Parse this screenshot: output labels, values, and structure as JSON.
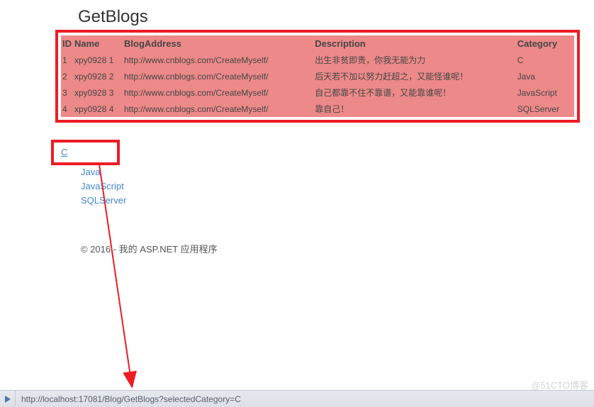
{
  "page_title": "GetBlogs",
  "table": {
    "headers": {
      "id": "ID",
      "name": "Name",
      "address": "BlogAddress",
      "description": "Description",
      "category": "Category"
    },
    "rows": [
      {
        "id": "1",
        "name": "xpy0928 1",
        "address": "http://www.cnblogs.com/CreateMyself/",
        "description": "出生非贫即贵，你我无能为力",
        "category": "C"
      },
      {
        "id": "2",
        "name": "xpy0928 2",
        "address": "http://www.cnblogs.com/CreateMyself/",
        "description": "后天若不加以努力赶超之，又能怪谁呢！",
        "category": "Java"
      },
      {
        "id": "3",
        "name": "xpy0928 3",
        "address": "http://www.cnblogs.com/CreateMyself/",
        "description": "自己都靠不住不靠谱，又能靠谁呢！",
        "category": "JavaScript"
      },
      {
        "id": "4",
        "name": "xpy0928 4",
        "address": "http://www.cnblogs.com/CreateMyself/",
        "description": "靠自己！",
        "category": "SQLServer"
      }
    ]
  },
  "categories": [
    "C",
    "Java",
    "JavaScript",
    "SQLServer"
  ],
  "footer_text": "© 2016 - 我的 ASP.NET 应用程序",
  "status_url": "http://localhost:17081/Blog/GetBlogs?selectedCategory=C",
  "watermark": "@51CTO博客"
}
